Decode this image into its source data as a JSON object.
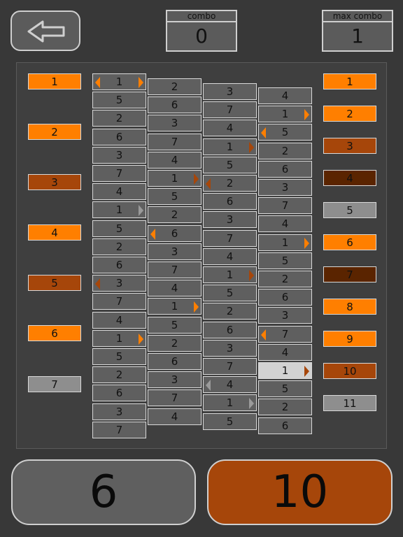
{
  "header": {
    "back_icon": "left-arrow-icon",
    "combo_label": "combo",
    "combo_value": "0",
    "max_combo_label": "max combo",
    "max_combo_value": "1"
  },
  "colors": {
    "c1": "#ff7f00",
    "c2": "#ff7f00",
    "c3": "#a6460a",
    "c4": "#5a2400",
    "c5": "#8e8e8e",
    "c6": "#ff7f00",
    "c7": "#5a2400",
    "c8": "#ff7f00",
    "c9": "#ff7f00",
    "c10": "#a6460a",
    "c11": "#8e8e8e",
    "left_column": [
      "#ff7f00",
      "#ff7f00",
      "#a6460a",
      "#ff7f00",
      "#a6460a",
      "#ff7f00",
      "#8e8e8e"
    ],
    "selector": "#ff7f00",
    "selector_dark": "#a6460a",
    "selector_grey": "#9a9a9a"
  },
  "left_column": [
    "1",
    "2",
    "3",
    "4",
    "5",
    "6",
    "7"
  ],
  "right_column": [
    "1",
    "2",
    "3",
    "4",
    "5",
    "6",
    "7",
    "8",
    "9",
    "10",
    "11"
  ],
  "reels": [
    {
      "cells": [
        "1",
        "5",
        "2",
        "6",
        "3",
        "7",
        "4",
        "1",
        "5",
        "2",
        "6",
        "3",
        "7",
        "4",
        "1",
        "5",
        "2",
        "6",
        "3",
        "7"
      ],
      "arrows": [
        {
          "i": 0,
          "side": "both",
          "tone": "selector"
        },
        {
          "i": 7,
          "side": "r",
          "tone": "selector_grey"
        },
        {
          "i": 11,
          "side": "l",
          "tone": "selector_dark"
        },
        {
          "i": 14,
          "side": "r",
          "tone": "selector"
        }
      ]
    },
    {
      "cells": [
        "2",
        "6",
        "3",
        "7",
        "4",
        "1",
        "5",
        "2",
        "6",
        "3",
        "7",
        "4",
        "1",
        "5",
        "2",
        "6",
        "3",
        "7",
        "4"
      ],
      "arrows": [
        {
          "i": 5,
          "side": "r",
          "tone": "selector_dark"
        },
        {
          "i": 8,
          "side": "l",
          "tone": "selector"
        },
        {
          "i": 12,
          "side": "r",
          "tone": "selector"
        }
      ]
    },
    {
      "cells": [
        "3",
        "7",
        "4",
        "1",
        "5",
        "2",
        "6",
        "3",
        "7",
        "4",
        "1",
        "5",
        "2",
        "6",
        "3",
        "7",
        "4",
        "1",
        "5"
      ],
      "arrows": [
        {
          "i": 3,
          "side": "r",
          "tone": "selector_dark"
        },
        {
          "i": 5,
          "side": "l",
          "tone": "selector_dark"
        },
        {
          "i": 10,
          "side": "r",
          "tone": "selector_dark"
        },
        {
          "i": 16,
          "side": "l",
          "tone": "selector_grey"
        },
        {
          "i": 17,
          "side": "r",
          "tone": "selector_grey"
        }
      ]
    },
    {
      "cells": [
        "4",
        "1",
        "5",
        "2",
        "6",
        "3",
        "7",
        "4",
        "1",
        "5",
        "2",
        "6",
        "3",
        "7",
        "4",
        "1",
        "5",
        "2",
        "6"
      ],
      "arrows": [
        {
          "i": 1,
          "side": "r",
          "tone": "selector"
        },
        {
          "i": 2,
          "side": "l",
          "tone": "selector"
        },
        {
          "i": 8,
          "side": "r",
          "tone": "selector"
        },
        {
          "i": 13,
          "side": "l",
          "tone": "selector"
        },
        {
          "i": 15,
          "side": "r",
          "tone": "selector_dark"
        }
      ],
      "highlight": 15
    }
  ],
  "bottom": {
    "left_value": "6",
    "right_value": "10",
    "left_bg": "#5f5f5f",
    "right_bg": "#a6460a"
  }
}
